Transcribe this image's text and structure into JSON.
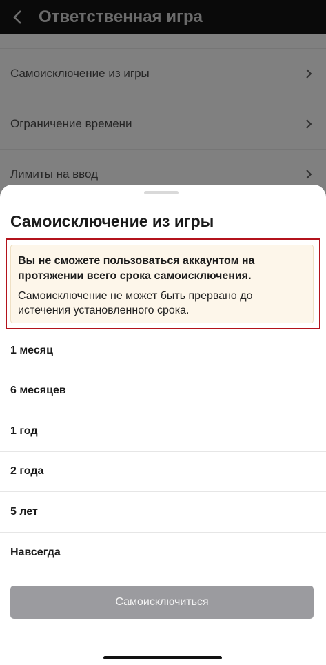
{
  "header": {
    "title": "Ответственная игра"
  },
  "background_menu": {
    "items": [
      {
        "label": "Самоисключение из игры"
      },
      {
        "label": "Ограничение времени"
      },
      {
        "label": "Лимиты на ввод"
      }
    ]
  },
  "sheet": {
    "title": "Самоисключение из игры",
    "warning": {
      "bold": "Вы не сможете пользоваться аккаунтом на протяжении всего срока самоисключения.",
      "text": "Самоисключение не может быть прервано до истечения установленного срока."
    },
    "options": [
      {
        "label": "1 месяц"
      },
      {
        "label": "6 месяцев"
      },
      {
        "label": "1 год"
      },
      {
        "label": "2 года"
      },
      {
        "label": "5 лет"
      },
      {
        "label": "Навсегда"
      }
    ],
    "submit_label": "Самоисключиться"
  },
  "colors": {
    "header_bg": "#0a0a0a",
    "overlay": "#808080",
    "warning_bg": "#fdf6ea",
    "highlight_outline": "#b3131c",
    "button_disabled": "#9b9b9f"
  }
}
